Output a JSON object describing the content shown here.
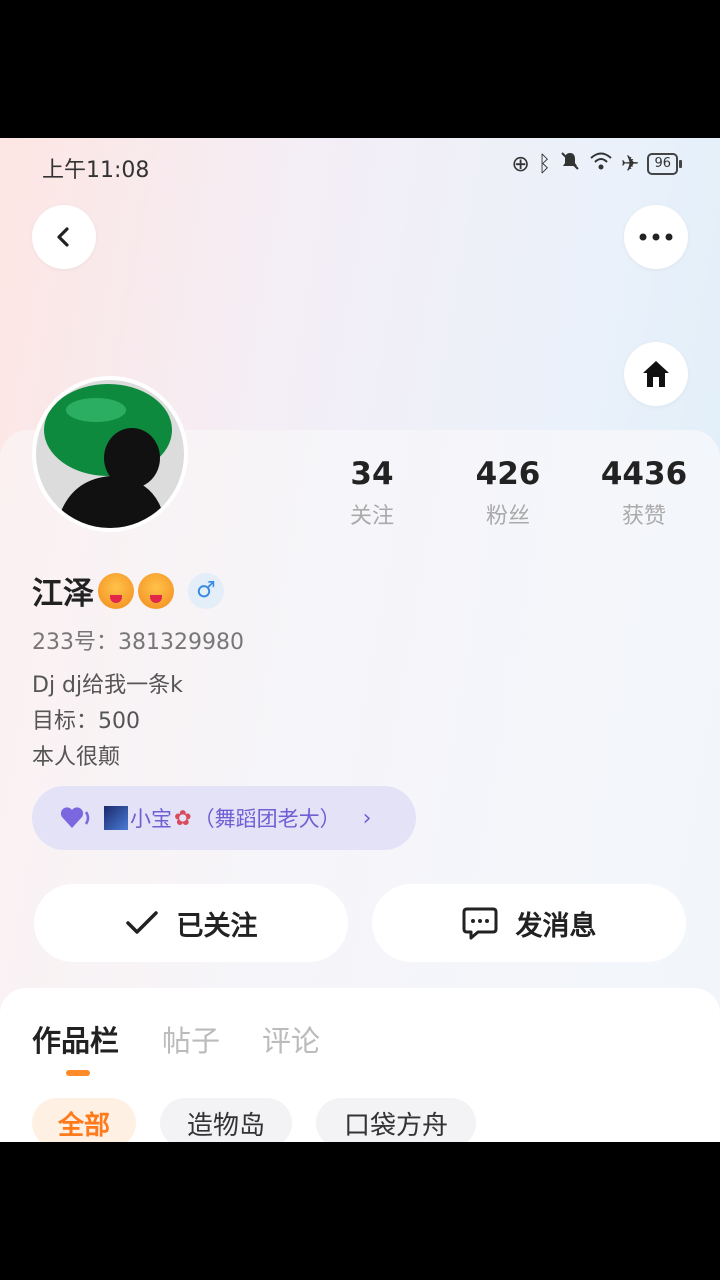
{
  "status_bar": {
    "time": "上午11:08",
    "battery": "96"
  },
  "profile": {
    "name": "江泽",
    "id_label": "233号：381329980",
    "bio_lines": [
      "Dj dj给我一条k",
      "目标：500",
      "本人很颠"
    ],
    "gender_symbol": "♂"
  },
  "stats": [
    {
      "value": "34",
      "label": "关注"
    },
    {
      "value": "426",
      "label": "粉丝"
    },
    {
      "value": "4436",
      "label": "获赞"
    }
  ],
  "group": {
    "text": "小宝",
    "role": "（舞蹈团老大）"
  },
  "actions": {
    "follow_label": "已关注",
    "message_label": "发消息"
  },
  "tabs": [
    {
      "label": "作品栏",
      "active": true
    },
    {
      "label": "帖子",
      "active": false
    },
    {
      "label": "评论",
      "active": false
    }
  ],
  "filters": [
    {
      "label": "全部",
      "active": true
    },
    {
      "label": "造物岛",
      "active": false
    },
    {
      "label": "口袋方舟",
      "active": false
    }
  ],
  "colors": {
    "accent": "#ff8a2a",
    "group_purple": "#6f5fd4",
    "gender_blue": "#3a8be0"
  }
}
